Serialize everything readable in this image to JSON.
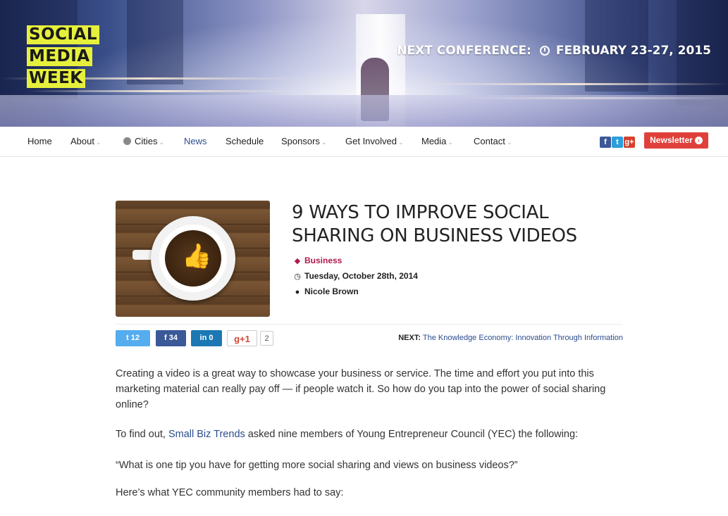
{
  "logo": {
    "line1": "SOCIAL",
    "line2": "MEDIA",
    "line3": "WEEK"
  },
  "hero": {
    "next_label": "NEXT CONFERENCE:",
    "dates": "FEBRUARY 23-27, 2015"
  },
  "nav": {
    "items": [
      {
        "label": "Home",
        "dropdown": false
      },
      {
        "label": "About",
        "dropdown": true
      },
      {
        "label": "Cities",
        "dropdown": true
      },
      {
        "label": "News",
        "dropdown": false,
        "active": true
      },
      {
        "label": "Schedule",
        "dropdown": false
      },
      {
        "label": "Sponsors",
        "dropdown": true
      },
      {
        "label": "Get Involved",
        "dropdown": true
      },
      {
        "label": "Media",
        "dropdown": true
      },
      {
        "label": "Contact",
        "dropdown": true
      }
    ],
    "social": {
      "facebook": "f",
      "twitter": "t",
      "google": "g+"
    },
    "newsletter": "Newsletter",
    "caret": "⌄"
  },
  "article": {
    "title": "9 WAYS TO IMPROVE SOCIAL SHARING ON BUSINESS VIDEOS",
    "category": "Business",
    "date": "Tuesday, October 28th, 2014",
    "author": "Nicole Brown"
  },
  "share": {
    "twitter_count": "12",
    "facebook_count": "34",
    "linkedin_count": "0",
    "gplus_label": "g+1",
    "gplus_count": "2",
    "next_label": "NEXT:",
    "next_title": "The Knowledge Economy: Innovation Through Information"
  },
  "body": {
    "p1": "Creating a video is a great way to showcase your business or service. The time and effort you put into this marketing material can really pay off — if people watch it. So how do you tap into the power of social sharing online?",
    "p2_pre": "To find out, ",
    "p2_link": "Small Biz Trends",
    "p2_post": " asked nine members of Young Entrepreneur Council (YEC) the following:",
    "p3": "“What is one tip you have for getting more social sharing and views on business videos?”",
    "p4": "Here’s what YEC community members had to say:"
  },
  "colors": {
    "accent_yellow": "#e6f03c",
    "newsletter_red": "#e0403b",
    "link_blue": "#2b4c8c",
    "category_red": "#b11a4f"
  }
}
